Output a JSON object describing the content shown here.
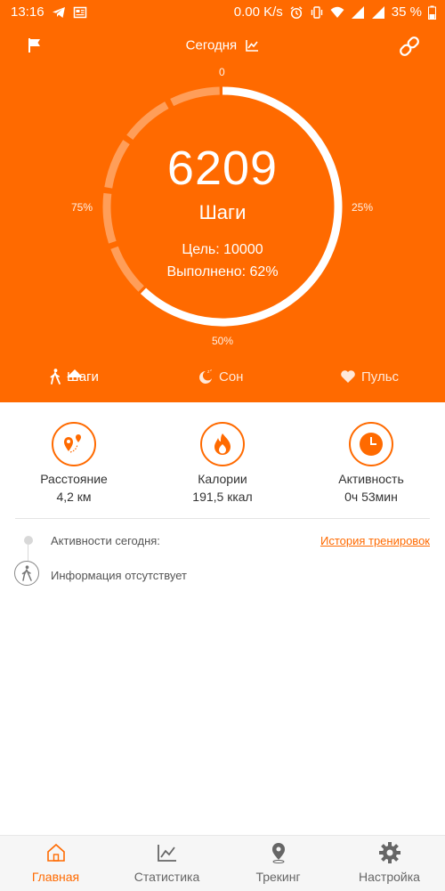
{
  "status_bar": {
    "time": "13:16",
    "speed": "0.00 K/s",
    "battery": "35 %"
  },
  "header": {
    "title": "Сегодня",
    "icons": [
      "flag-icon",
      "chart-icon",
      "link-icon"
    ]
  },
  "ring": {
    "tick_top": "0",
    "tick_right": "25%",
    "tick_bottom": "50%",
    "tick_left": "75%",
    "progress_fraction": 0.62,
    "steps": "6209",
    "steps_label": "Шаги",
    "goal": "Цель: 10000",
    "completed": "Выполнено: 62%"
  },
  "tabs": [
    {
      "label": "Шаги",
      "icon": "walk-icon",
      "active": true
    },
    {
      "label": "Сон",
      "icon": "moon-icon",
      "active": false
    },
    {
      "label": "Пульс",
      "icon": "heart-icon",
      "active": false
    }
  ],
  "metrics": [
    {
      "name": "Расстояние",
      "value": "4,2 км",
      "icon": "route-pin-icon"
    },
    {
      "name": "Калории",
      "value": "191,5 ккал",
      "icon": "flame-icon"
    },
    {
      "name": "Активность",
      "value": "0ч 53мин",
      "icon": "clock-icon"
    }
  ],
  "activity": {
    "title": "Активности сегодня:",
    "history_link": "История тренировок",
    "empty": "Информация отсутствует"
  },
  "bottom_nav": [
    {
      "label": "Главная",
      "icon": "home-icon",
      "active": true
    },
    {
      "label": "Статистика",
      "icon": "stats-icon",
      "active": false
    },
    {
      "label": "Трекинг",
      "icon": "location-icon",
      "active": false
    },
    {
      "label": "Настройка",
      "icon": "gear-icon",
      "active": false
    }
  ],
  "colors": {
    "accent": "#ff6a00",
    "background": "#ffffff",
    "text": "#333333",
    "muted": "#666666"
  }
}
